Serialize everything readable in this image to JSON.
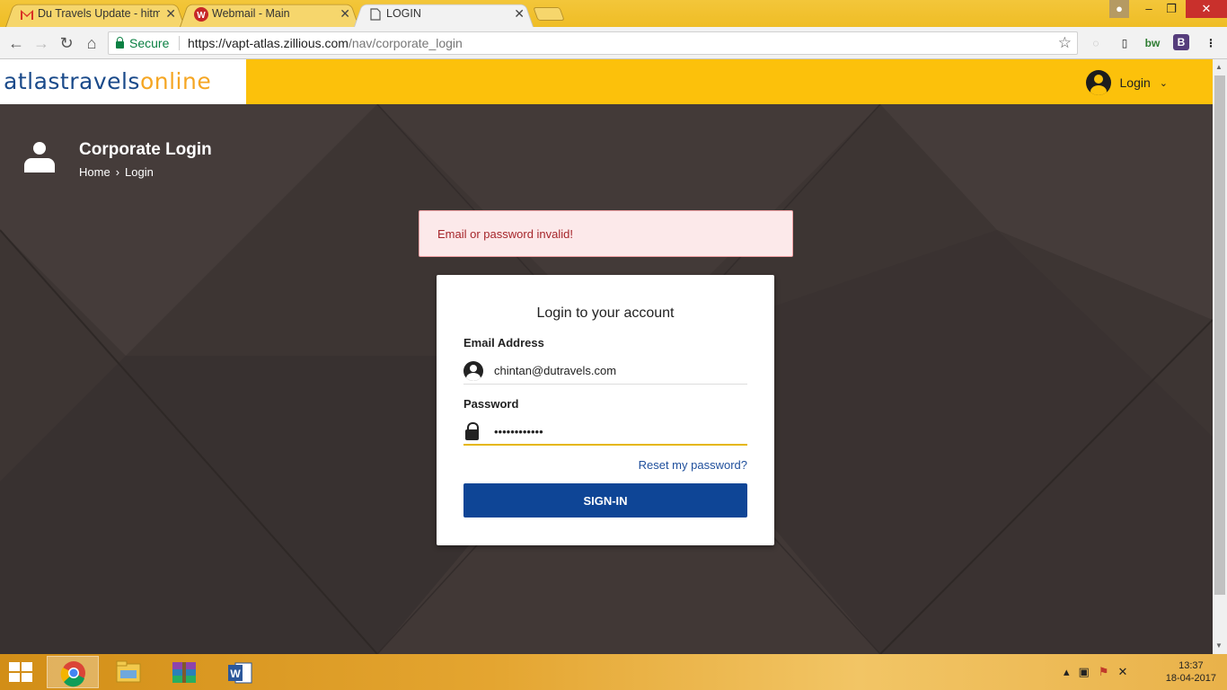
{
  "browser": {
    "tabs": [
      {
        "title": "Du Travels Update - hitm",
        "favicon": "gmail-icon",
        "active": false
      },
      {
        "title": "Webmail - Main",
        "favicon": "webmail-icon",
        "active": false
      },
      {
        "title": "LOGIN",
        "favicon": "page-icon",
        "active": true
      }
    ],
    "secure_label": "Secure",
    "url_host": "https://vapt-atlas.zillious.com",
    "url_path": "/nav/corporate_login"
  },
  "site": {
    "logo_part1": "atlastravels",
    "logo_part2": "online",
    "header_login_label": "Login"
  },
  "page": {
    "title": "Corporate Login",
    "breadcrumb": {
      "home": "Home",
      "separator": "›",
      "current": "Login"
    },
    "alert": "Email or password invalid!"
  },
  "login_card": {
    "title": "Login to your account",
    "email_label": "Email Address",
    "email_value": "chintan@dutravels.com",
    "password_label": "Password",
    "password_value": "••••••••••••",
    "reset_link": "Reset my password?",
    "signin_button": "SIGN-IN"
  },
  "taskbar": {
    "time": "13:37",
    "date": "18-04-2017"
  },
  "colors": {
    "accent_yellow": "#fcc10b",
    "button_blue": "#0e4596",
    "alert_bg": "#fce9ea",
    "alert_text": "#a6262b",
    "page_bg": "#3d3533"
  }
}
